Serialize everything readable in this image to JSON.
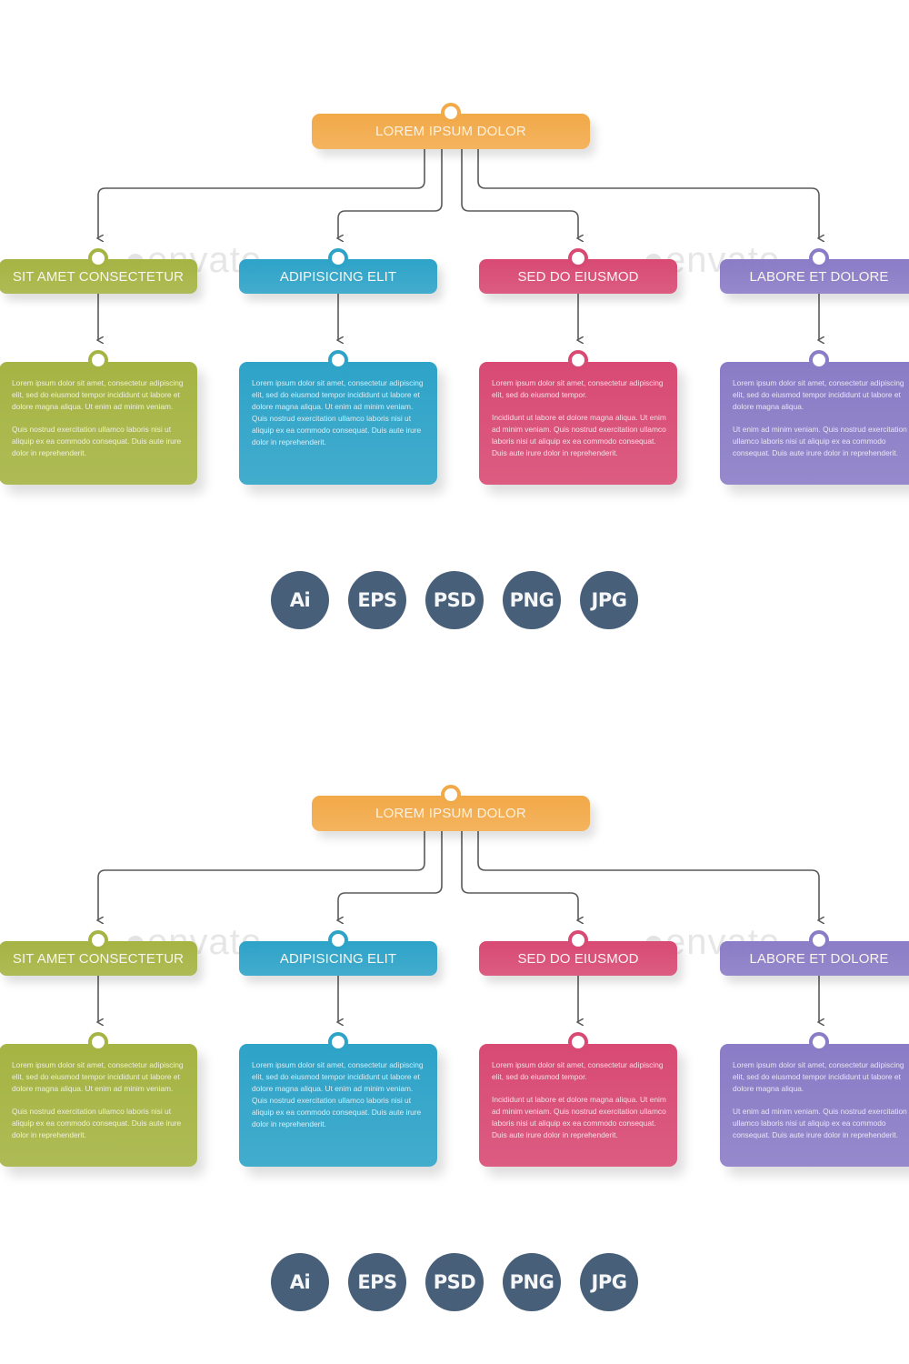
{
  "panels_count": 2,
  "chart": {
    "root": {
      "label": "LOREM IPSUM DOLOR",
      "color": "#f2a948"
    },
    "branches": [
      {
        "label": "SIT AMET CONSECTETUR",
        "color": "#a5b443",
        "paragraphs": [
          "Lorem ipsum dolor sit amet, consectetur adipiscing elit, sed do eiusmod tempor incididunt ut labore et dolore magna aliqua. Ut enim ad minim veniam.",
          "Quis nostrud exercitation ullamco laboris nisi ut aliquip ex ea commodo consequat. Duis aute irure dolor in reprehenderit."
        ]
      },
      {
        "label": "ADIPISICING ELIT",
        "color": "#2ea3c8",
        "paragraphs": [
          "Lorem ipsum dolor sit amet, consectetur adipiscing elit, sed do eiusmod tempor incididunt ut labore et dolore magna aliqua. Ut enim ad minim veniam. Quis nostrud exercitation ullamco laboris nisi ut aliquip ex ea commodo consequat. Duis aute irure dolor in reprehenderit."
        ]
      },
      {
        "label": "SED DO EIUSMOD",
        "color": "#d84a74",
        "paragraphs": [
          "Lorem ipsum dolor sit amet, consectetur adipiscing elit, sed do eiusmod tempor.",
          "Incididunt ut labore et dolore magna aliqua. Ut enim ad minim veniam. Quis nostrud exercitation ullamco laboris nisi ut aliquip ex ea commodo consequat. Duis aute irure dolor in reprehenderit."
        ]
      },
      {
        "label": "LABORE ET DOLORE",
        "color": "#8a7cc6",
        "paragraphs": [
          "Lorem ipsum dolor sit amet, consectetur adipiscing elit, sed do eiusmod tempor incididunt ut labore et dolore magna aliqua.",
          "Ut enim ad minim veniam. Quis nostrud exercitation ullamco laboris nisi ut aliquip ex ea commodo consequat. Duis aute irure dolor in reprehenderit."
        ]
      }
    ]
  },
  "formats": [
    "Ai",
    "EPS",
    "PSD",
    "PNG",
    "JPG"
  ],
  "format_color": "#485f7a",
  "connector_color": "#5a5a5a",
  "watermark": "envato"
}
